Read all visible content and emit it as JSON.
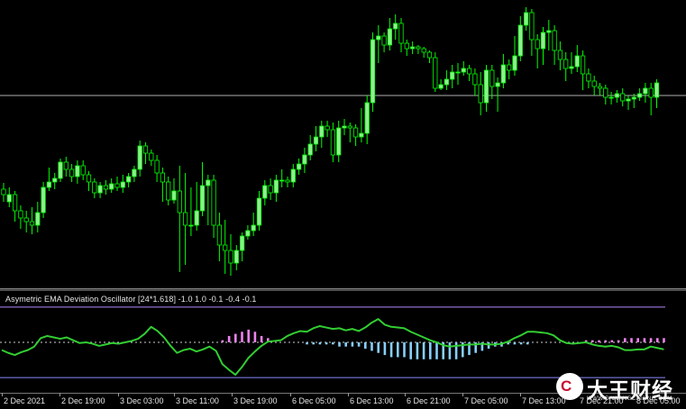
{
  "colors": {
    "background": "#000000",
    "bull": "#90ee90",
    "bear": "#000000",
    "wick": "#00ff00",
    "hline": "#b0b0b0",
    "osc_line": "#32cd32",
    "level_line": "#b388ff",
    "level_lower": "#8a8aff",
    "zero_line": "#d0d0d0",
    "hist_pos": "#ee82ee",
    "hist_neg": "#87cefa"
  },
  "oscillator": {
    "label": "Asymetric EMA Deviation Oscillator [24*1.618] -1.0 1.0 -0.1 -0.4 -0.1"
  },
  "time_axis": {
    "labels": [
      "2 Dec 2021",
      "2 Dec 19:00",
      "3 Dec 03:00",
      "3 Dec 11:00",
      "3 Dec 19:00",
      "6 Dec 05:00",
      "6 Dec 13:00",
      "6 Dec 21:00",
      "7 Dec 05:00",
      "7 Dec 13:00",
      "7 Dec 21:00",
      "8 Dec 05:00"
    ]
  },
  "watermark": {
    "text": "大王财经",
    "site": "WWW.DAWANGCAIJING.COM",
    "icon": "dawang-logo-icon"
  },
  "chart_data": [
    {
      "type": "candlestick",
      "title": "",
      "notes": "Price chart candles (relative price units, higher = higher on screen, 0 = bottom of panel)",
      "ylim": [
        0,
        320
      ],
      "horizontal_level": 214,
      "candles": [
        [
          110,
          104,
          117,
          96
        ],
        [
          96,
          104,
          112,
          90
        ],
        [
          104,
          86,
          108,
          74
        ],
        [
          86,
          78,
          92,
          66
        ],
        [
          78,
          74,
          86,
          62
        ],
        [
          74,
          70,
          90,
          60
        ],
        [
          70,
          84,
          96,
          62
        ],
        [
          84,
          112,
          118,
          78
        ],
        [
          112,
          118,
          134,
          108
        ],
        [
          118,
          122,
          128,
          110
        ],
        [
          122,
          140,
          144,
          118
        ],
        [
          140,
          132,
          146,
          124
        ],
        [
          132,
          124,
          138,
          118
        ],
        [
          124,
          136,
          142,
          116
        ],
        [
          136,
          126,
          142,
          120
        ],
        [
          126,
          118,
          130,
          108
        ],
        [
          118,
          106,
          122,
          100
        ],
        [
          106,
          114,
          118,
          100
        ],
        [
          114,
          110,
          120,
          104
        ],
        [
          110,
          116,
          122,
          106
        ],
        [
          116,
          112,
          124,
          108
        ],
        [
          112,
          118,
          126,
          106
        ],
        [
          118,
          124,
          128,
          112
        ],
        [
          124,
          132,
          136,
          118
        ],
        [
          132,
          158,
          164,
          124
        ],
        [
          158,
          150,
          162,
          138
        ],
        [
          150,
          142,
          154,
          136
        ],
        [
          142,
          128,
          148,
          118
        ],
        [
          128,
          118,
          134,
          96
        ],
        [
          118,
          98,
          124,
          92
        ],
        [
          98,
          108,
          122,
          94
        ],
        [
          108,
          84,
          136,
          18
        ],
        [
          84,
          70,
          128,
          26
        ],
        [
          70,
          70,
          112,
          58
        ],
        [
          70,
          86,
          118,
          64
        ],
        [
          86,
          114,
          140,
          80
        ],
        [
          114,
          120,
          126,
          70
        ],
        [
          120,
          70,
          126,
          56
        ],
        [
          70,
          48,
          84,
          30
        ],
        [
          48,
          42,
          76,
          16
        ],
        [
          42,
          28,
          60,
          14
        ],
        [
          28,
          42,
          48,
          20
        ],
        [
          42,
          58,
          62,
          30
        ],
        [
          58,
          64,
          70,
          54
        ],
        [
          64,
          70,
          84,
          58
        ],
        [
          70,
          100,
          108,
          64
        ],
        [
          100,
          114,
          120,
          92
        ],
        [
          114,
          106,
          122,
          98
        ],
        [
          106,
          120,
          126,
          96
        ],
        [
          120,
          120,
          132,
          112
        ],
        [
          120,
          118,
          124,
          112
        ],
        [
          118,
          132,
          138,
          112
        ],
        [
          132,
          138,
          144,
          126
        ],
        [
          138,
          148,
          156,
          128
        ],
        [
          148,
          160,
          170,
          142
        ],
        [
          160,
          168,
          180,
          152
        ],
        [
          168,
          180,
          186,
          156
        ],
        [
          180,
          176,
          186,
          168
        ],
        [
          176,
          148,
          184,
          140
        ],
        [
          148,
          178,
          186,
          140
        ],
        [
          178,
          180,
          188,
          170
        ],
        [
          180,
          178,
          184,
          162
        ],
        [
          178,
          168,
          182,
          158
        ],
        [
          168,
          172,
          200,
          162
        ],
        [
          172,
          206,
          214,
          160
        ],
        [
          206,
          276,
          284,
          196
        ],
        [
          276,
          280,
          292,
          250
        ],
        [
          280,
          270,
          284,
          262
        ],
        [
          270,
          288,
          300,
          264
        ],
        [
          288,
          294,
          304,
          276
        ],
        [
          294,
          272,
          300,
          262
        ],
        [
          272,
          266,
          276,
          258
        ],
        [
          266,
          268,
          274,
          260
        ],
        [
          268,
          266,
          270,
          260
        ],
        [
          266,
          262,
          268,
          256
        ],
        [
          262,
          256,
          264,
          250
        ],
        [
          256,
          222,
          262,
          218
        ],
        [
          222,
          226,
          232,
          220
        ],
        [
          226,
          232,
          242,
          220
        ],
        [
          232,
          240,
          248,
          222
        ],
        [
          240,
          240,
          250,
          226
        ],
        [
          240,
          244,
          252,
          236
        ],
        [
          244,
          238,
          248,
          230
        ],
        [
          238,
          226,
          244,
          214
        ],
        [
          226,
          206,
          240,
          192
        ],
        [
          206,
          242,
          248,
          196
        ],
        [
          242,
          224,
          248,
          210
        ],
        [
          224,
          228,
          234,
          196
        ],
        [
          228,
          248,
          260,
          222
        ],
        [
          248,
          242,
          254,
          232
        ],
        [
          242,
          258,
          280,
          236
        ],
        [
          258,
          292,
          302,
          252
        ],
        [
          292,
          306,
          312,
          286
        ],
        [
          306,
          276,
          310,
          258
        ],
        [
          276,
          266,
          282,
          244
        ],
        [
          266,
          284,
          290,
          248
        ],
        [
          284,
          286,
          298,
          264
        ],
        [
          286,
          264,
          292,
          248
        ],
        [
          264,
          254,
          274,
          242
        ],
        [
          254,
          244,
          262,
          230
        ],
        [
          244,
          246,
          262,
          238
        ],
        [
          246,
          258,
          270,
          240
        ],
        [
          258,
          238,
          264,
          220
        ],
        [
          238,
          230,
          244,
          222
        ],
        [
          230,
          224,
          236,
          214
        ],
        [
          224,
          222,
          228,
          214
        ],
        [
          222,
          212,
          226,
          204
        ],
        [
          212,
          212,
          218,
          204
        ],
        [
          212,
          216,
          220,
          206
        ],
        [
          216,
          208,
          222,
          202
        ],
        [
          208,
          210,
          214,
          198
        ],
        [
          210,
          212,
          216,
          200
        ],
        [
          212,
          216,
          222,
          208
        ],
        [
          216,
          222,
          228,
          206
        ],
        [
          222,
          212,
          228,
          192
        ],
        [
          212,
          228,
          232,
          200
        ]
      ]
    },
    {
      "type": "line",
      "title": "",
      "series": [
        {
          "values": [
            -0.22,
            -0.3,
            -0.36,
            -0.28,
            -0.22,
            -0.12,
            0.12,
            0.18,
            0.14,
            0.1,
            0.14,
            0.06,
            -0.02,
            0.0,
            -0.04,
            -0.1,
            -0.06,
            -0.02,
            -0.04,
            0.0,
            0.04,
            0.1,
            0.24,
            0.44,
            0.32,
            0.14,
            -0.1,
            -0.3,
            -0.22,
            -0.18,
            -0.26,
            -0.2,
            -0.12,
            -0.24,
            -0.62,
            -0.78,
            -0.92,
            -0.7,
            -0.44,
            -0.26,
            -0.1,
            0.02,
            0.04,
            0.06,
            0.18,
            0.26,
            0.32,
            0.3,
            0.4,
            0.46,
            0.42,
            0.38,
            0.4,
            0.34,
            0.38,
            0.32,
            0.42,
            0.56,
            0.66,
            0.5,
            0.44,
            0.42,
            0.4,
            0.3,
            0.22,
            0.14,
            0.06,
            0.0,
            -0.08,
            -0.12,
            -0.1,
            -0.08,
            -0.06,
            -0.06,
            -0.04,
            -0.06,
            -0.06,
            -0.04,
            0.02,
            0.12,
            0.2,
            0.3,
            0.3,
            0.28,
            0.26,
            0.2,
            0.06,
            -0.02,
            -0.04,
            -0.02,
            0.0,
            -0.06,
            -0.1,
            -0.12,
            -0.1,
            -0.14,
            -0.22,
            -0.22,
            -0.2,
            -0.2,
            -0.12,
            -0.16,
            -0.2
          ]
        }
      ],
      "levels": [
        1.0,
        -1.0,
        0.0
      ],
      "histogram": [
        0,
        0,
        0,
        0,
        0,
        0,
        0,
        0,
        0,
        0,
        0,
        0,
        0,
        0,
        0,
        0,
        0,
        0,
        0,
        0,
        0,
        0,
        0,
        0,
        0,
        0,
        0,
        0,
        0,
        0,
        0,
        0,
        0,
        0,
        0.02,
        0.06,
        0.08,
        0.1,
        0.12,
        0.1,
        0.06,
        0.04,
        0,
        0,
        0,
        0,
        0,
        -0.02,
        -0.02,
        -0.02,
        -0.02,
        -0.02,
        -0.04,
        -0.04,
        -0.04,
        -0.04,
        -0.06,
        -0.08,
        -0.1,
        -0.12,
        -0.14,
        -0.14,
        -0.14,
        -0.16,
        -0.16,
        -0.16,
        -0.16,
        -0.16,
        -0.16,
        -0.16,
        -0.16,
        -0.14,
        -0.12,
        -0.1,
        -0.08,
        -0.06,
        -0.04,
        -0.04,
        -0.02,
        -0.02,
        -0.02,
        -0.02,
        0,
        0,
        0,
        0,
        0,
        0,
        0,
        0,
        0.02,
        0.02,
        0.02,
        0.02,
        0.02,
        0.02,
        0.04,
        0.04,
        0.04,
        0.04,
        0.04,
        0.04,
        0.04
      ],
      "ylim": [
        -1.2,
        1.2
      ]
    }
  ]
}
